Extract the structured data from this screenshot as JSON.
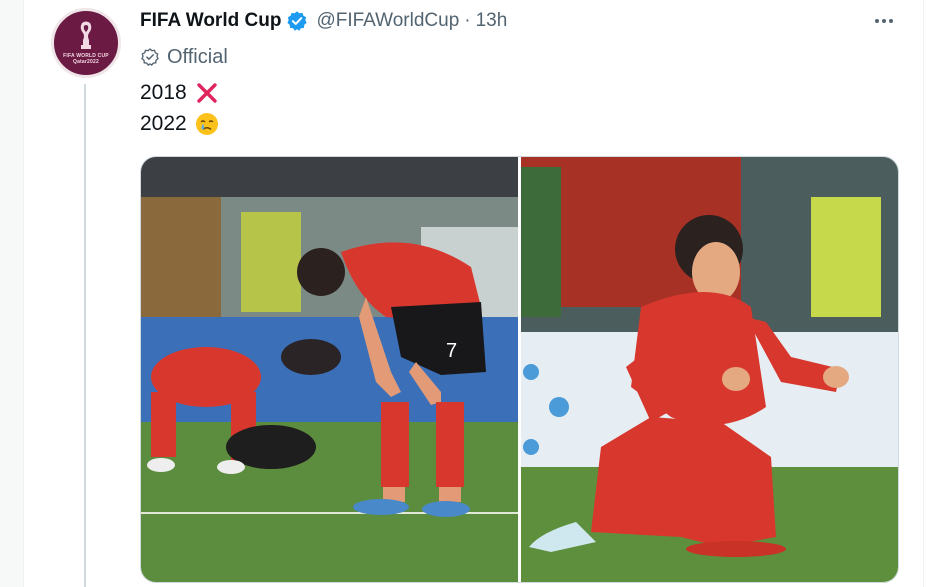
{
  "tweet": {
    "display_name": "FIFA World Cup",
    "handle": "@FIFAWorldCup",
    "separator": "·",
    "time": "13h",
    "official_label": "Official",
    "lines": [
      {
        "text": "2018",
        "emoji": "cross-mark-icon"
      },
      {
        "text": "2022",
        "emoji": "crying-face-icon"
      }
    ]
  },
  "avatar": {
    "text_line1": "FIFA WORLD CUP",
    "text_line2": "Qatar2022"
  },
  "media": {
    "images": [
      "korea-players-dejected-photo",
      "son-heung-min-celebrating-photo"
    ],
    "jersey_number": "7"
  },
  "colors": {
    "brand": "#6b1a43",
    "verified": "#1d9bf0",
    "cross": "#e0245e",
    "secondary_text": "#536471"
  }
}
